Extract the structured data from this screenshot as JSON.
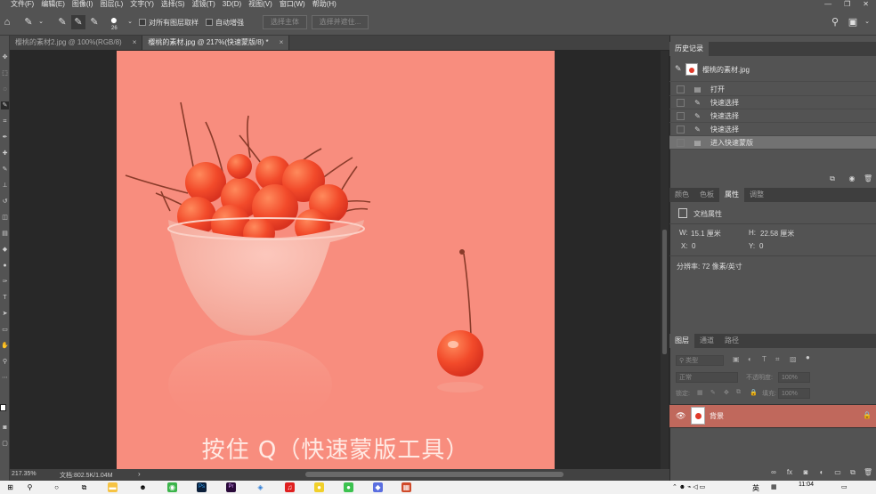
{
  "menu": [
    "文件(F)",
    "编辑(E)",
    "图像(I)",
    "图层(L)",
    "文字(Y)",
    "选择(S)",
    "滤镜(T)",
    "3D(D)",
    "视图(V)",
    "窗口(W)",
    "帮助(H)"
  ],
  "options_bar": {
    "brush_size": "26",
    "sample_all_layers": "对所有图层取样",
    "auto_enhance": "自动增强",
    "select_subject": "选择主体",
    "select_and_mask": "选择并遮住..."
  },
  "tabs": [
    {
      "label": "樱桃的素材2.jpg @ 100%(RGB/8)",
      "close": "×"
    },
    {
      "label": "樱桃的素材.jpg @ 217%(快速蒙版/8) *",
      "close": "×"
    }
  ],
  "canvas": {
    "caption": "按住 Q（快速蒙版工具）",
    "background": "#f88d7e"
  },
  "status": {
    "zoom": "217.35%",
    "doc": "文档:802.5K/1.04M",
    "arrow": "›"
  },
  "history": {
    "title": "历史记录",
    "snapshot": "樱桃的素材.jpg",
    "items": [
      "打开",
      "快速选择",
      "快速选择",
      "快速选择",
      "进入快速蒙版"
    ]
  },
  "properties": {
    "tabs": [
      "颜色",
      "色板",
      "属性",
      "调整"
    ],
    "doc_props": "文档属性",
    "w_label": "W:",
    "w_value": "15.1 厘米",
    "h_label": "H:",
    "h_value": "22.58 厘米",
    "x_label": "X:",
    "x_value": "0",
    "y_label": "Y:",
    "y_value": "0",
    "resolution": "分辨率: 72 像素/英寸"
  },
  "layers": {
    "tabs": [
      "图层",
      "通道",
      "路径"
    ],
    "filter": "类型",
    "blend_mode": "正常",
    "opacity_label": "不透明度:",
    "opacity_value": "100%",
    "lock_label": "锁定:",
    "fill_label": "填充:",
    "fill_value": "100%",
    "layer_name": "背景"
  },
  "taskbar": {
    "time": "11:04",
    "ime": "英"
  }
}
